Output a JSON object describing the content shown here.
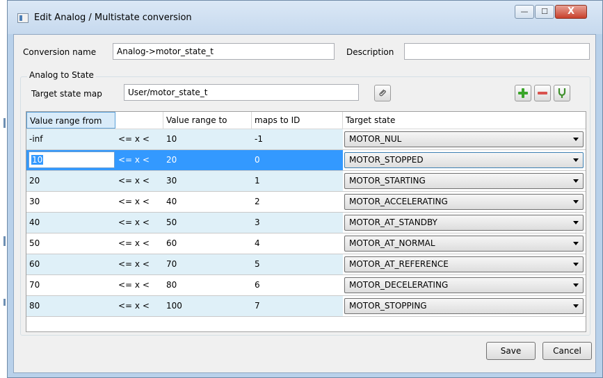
{
  "window": {
    "title": "Edit Analog / Multistate conversion",
    "controls": {
      "minimize": "—",
      "maximize": "☐",
      "close": "X"
    }
  },
  "conversion": {
    "name_label": "Conversion name",
    "name_value": "Analog->motor_state_t",
    "description_label": "Description",
    "description_value": ""
  },
  "group": {
    "title": "Analog to State",
    "target_map_label": "Target state map",
    "target_map_value": "User/motor_state_t"
  },
  "icons": {
    "attach": "paperclip-icon",
    "add": "plus-icon",
    "remove": "minus-icon",
    "edit": "tuning-fork-icon"
  },
  "colors": {
    "add": "#3aa52a",
    "remove": "#d9534f",
    "edit": "#3e8f2b",
    "selection": "#3399ff",
    "alt_row": "#dff0f8"
  },
  "table": {
    "headers": [
      "Value range from",
      "",
      "Value range to",
      "maps to ID",
      "Target state"
    ],
    "rows": [
      {
        "from": "-inf",
        "op": "<= x <",
        "to": "10",
        "id": "-1",
        "state": "MOTOR_NUL"
      },
      {
        "from": "10",
        "op": "<= x <",
        "to": "20",
        "id": "0",
        "state": "MOTOR_STOPPED"
      },
      {
        "from": "20",
        "op": "<= x <",
        "to": "30",
        "id": "1",
        "state": "MOTOR_STARTING"
      },
      {
        "from": "30",
        "op": "<= x <",
        "to": "40",
        "id": "2",
        "state": "MOTOR_ACCELERATING"
      },
      {
        "from": "40",
        "op": "<= x <",
        "to": "50",
        "id": "3",
        "state": "MOTOR_AT_STANDBY"
      },
      {
        "from": "50",
        "op": "<= x <",
        "to": "60",
        "id": "4",
        "state": "MOTOR_AT_NORMAL"
      },
      {
        "from": "60",
        "op": "<= x <",
        "to": "70",
        "id": "5",
        "state": "MOTOR_AT_REFERENCE"
      },
      {
        "from": "70",
        "op": "<= x <",
        "to": "80",
        "id": "6",
        "state": "MOTOR_DECELERATING"
      },
      {
        "from": "80",
        "op": "<= x <",
        "to": "100",
        "id": "7",
        "state": "MOTOR_STOPPING"
      }
    ]
  },
  "buttons": {
    "save": "Save",
    "cancel": "Cancel"
  }
}
